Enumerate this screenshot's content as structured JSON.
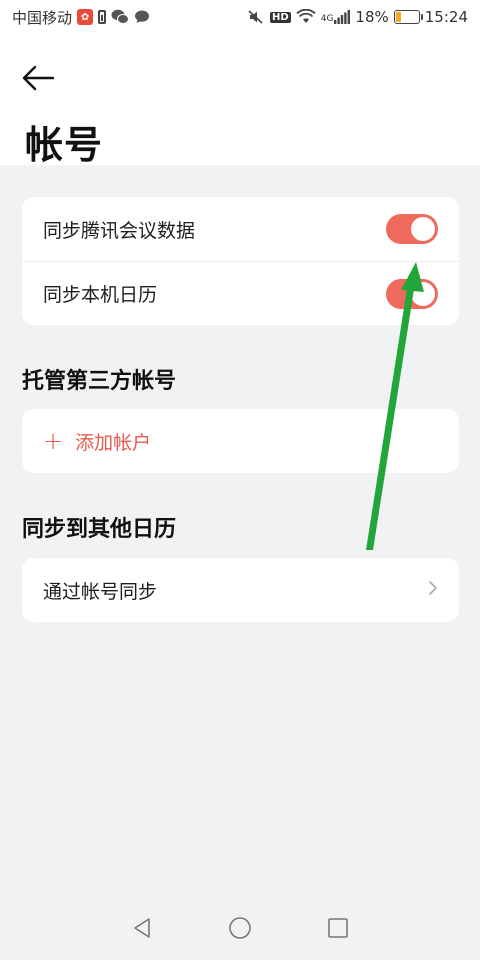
{
  "status_bar": {
    "carrier": "中国移动",
    "hd": "HD",
    "network": "4G",
    "battery_percent": "18%",
    "time": "15:24"
  },
  "header": {
    "title": "帐号"
  },
  "sync_settings": [
    {
      "label": "同步腾讯会议数据",
      "enabled": true
    },
    {
      "label": "同步本机日历",
      "enabled": true
    }
  ],
  "third_party": {
    "section_title": "托管第三方帐号",
    "add_account_label": "添加帐户"
  },
  "sync_other": {
    "section_title": "同步到其他日历",
    "item_label": "通过帐号同步"
  },
  "colors": {
    "accent": "#ee6a5d",
    "annotation_arrow": "#22a63a"
  },
  "icons": {
    "back": "back-arrow-icon",
    "chevron": "chevron-right-icon",
    "nav_back": "triangle-back-icon",
    "nav_home": "circle-home-icon",
    "nav_recent": "square-recent-icon"
  }
}
